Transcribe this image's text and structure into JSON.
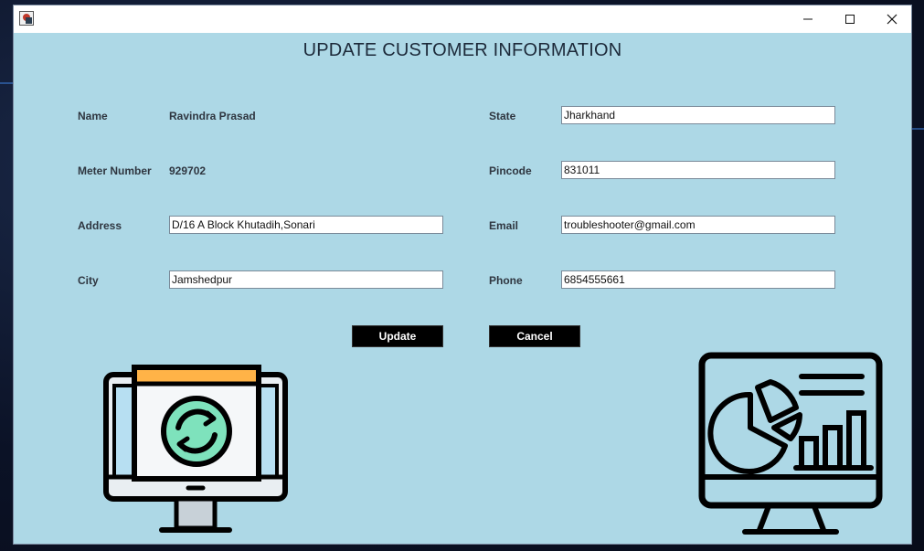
{
  "window": {
    "title": "",
    "controls": {
      "minimize": "minimize",
      "maximize": "maximize",
      "close": "close"
    }
  },
  "heading": "UPDATE CUSTOMER INFORMATION",
  "form": {
    "name_label": "Name",
    "name_value": "Ravindra Prasad",
    "meter_label": "Meter Number",
    "meter_value": "929702",
    "address_label": "Address",
    "address_value": "D/16 A Block Khutadih,Sonari",
    "city_label": "City",
    "city_value": "Jamshedpur",
    "state_label": "State",
    "state_value": "Jharkhand",
    "pincode_label": "Pincode",
    "pincode_value": "831011",
    "email_label": "Email",
    "email_value": "troubleshooter@gmail.com",
    "phone_label": "Phone",
    "phone_value": "6854555661"
  },
  "buttons": {
    "update_label": "Update",
    "cancel_label": "Cancel"
  },
  "illustrations": {
    "left": "monitor-refresh-icon",
    "right": "monitor-analytics-icon"
  },
  "colors": {
    "background": "#add8e6",
    "button_bg": "#000000",
    "button_text": "#ffffff",
    "refresh_green": "#7ee2bc",
    "header_orange": "#ffb347"
  }
}
